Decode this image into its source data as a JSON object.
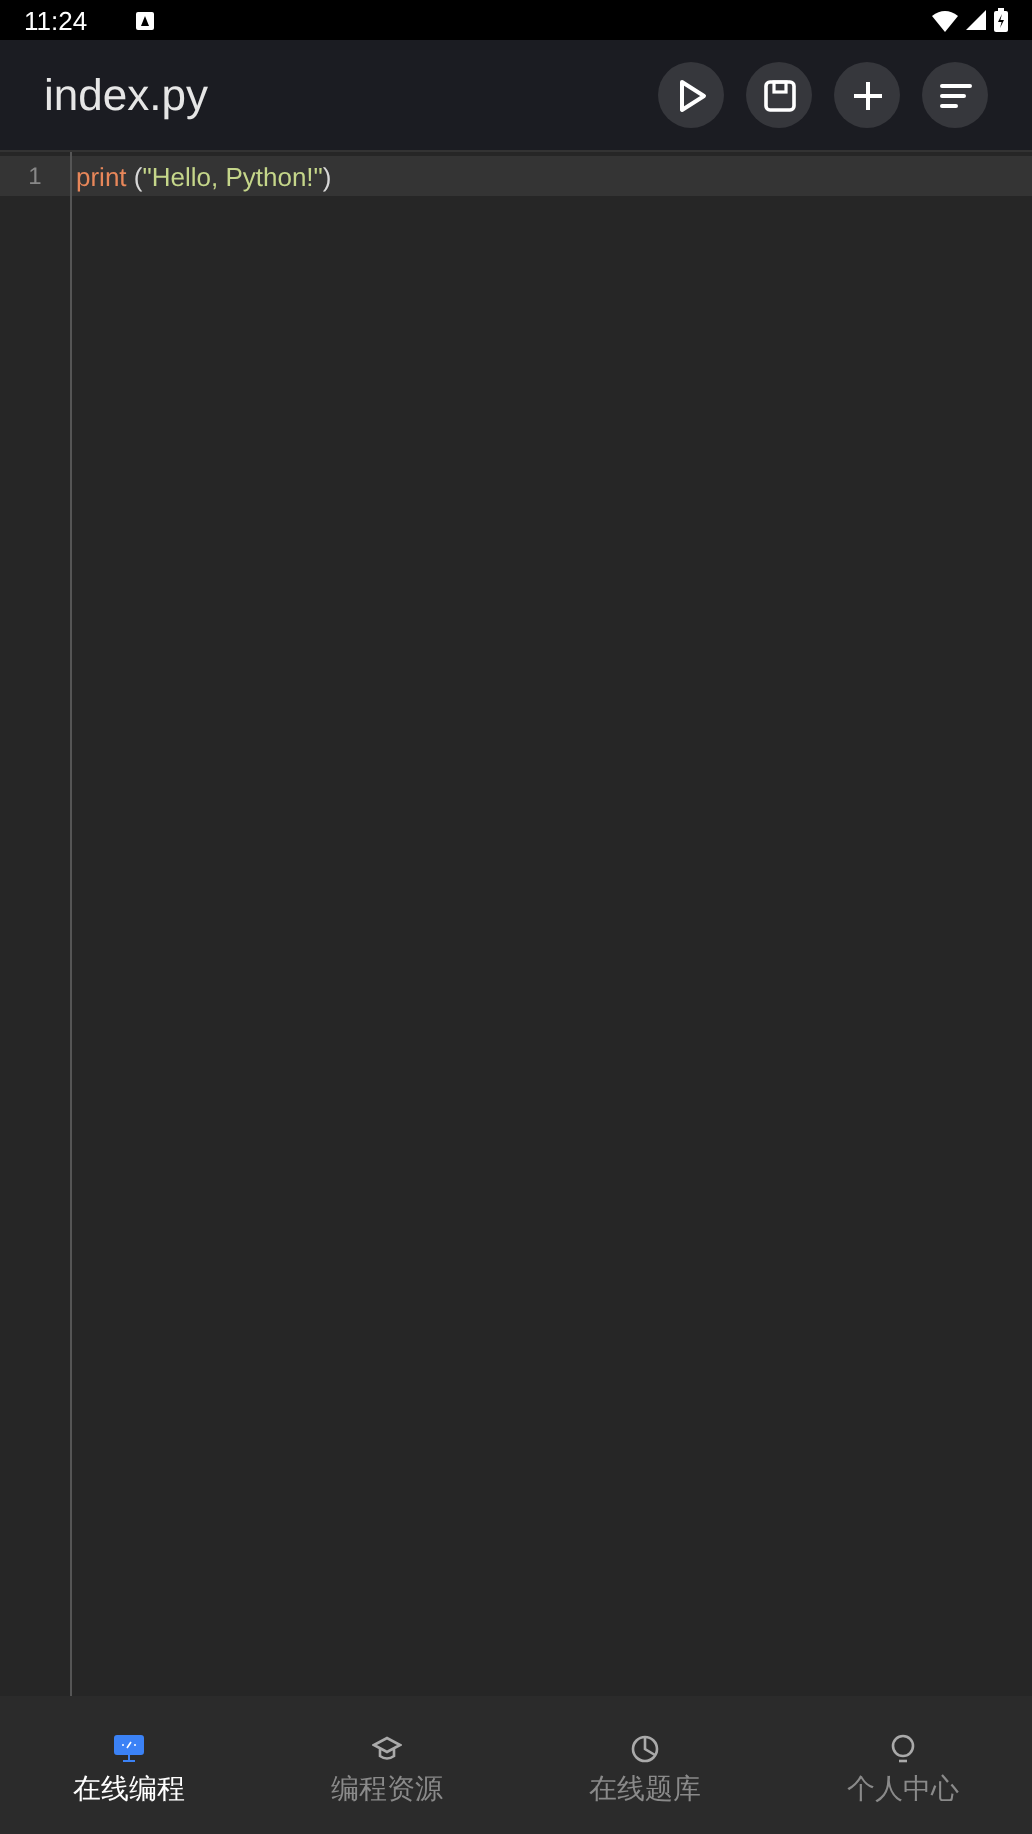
{
  "status_bar": {
    "time": "11:24"
  },
  "app_bar": {
    "title": "index.py"
  },
  "editor": {
    "lines": [
      {
        "number": "1",
        "active": true,
        "tokens": [
          {
            "kind": "function",
            "text": "print"
          },
          {
            "kind": "plain",
            "text": " ("
          },
          {
            "kind": "string",
            "text": "\"Hello, Python!\""
          },
          {
            "kind": "plain",
            "text": ")"
          }
        ]
      }
    ]
  },
  "bottom_nav": [
    {
      "label": "在线编程",
      "selected": true
    },
    {
      "label": "编程资源",
      "selected": false
    },
    {
      "label": "在线题库",
      "selected": false
    },
    {
      "label": "个人中心",
      "selected": false
    }
  ]
}
